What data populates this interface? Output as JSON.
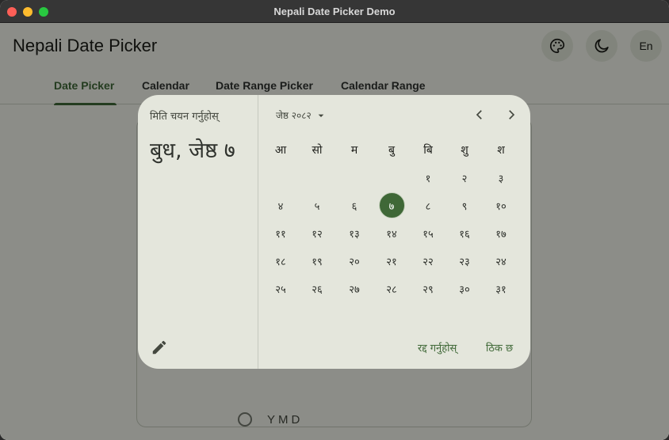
{
  "window": {
    "title": "Nepali Date Picker Demo"
  },
  "app": {
    "title": "Nepali Date Picker",
    "actions": {
      "language_label": "En"
    },
    "tabs": [
      {
        "label": "Date Picker",
        "active": true
      },
      {
        "label": "Calendar",
        "active": false
      },
      {
        "label": "Date Range Picker",
        "active": false
      },
      {
        "label": "Calendar Range",
        "active": false
      }
    ],
    "format_options": [
      {
        "label": "YMD",
        "selected": false
      }
    ]
  },
  "dialog": {
    "help_text": "मिति चयन गर्नुहोस्",
    "headline": "बुध, जेष्ठ ७",
    "month_label": "जेष्ठ २०८२",
    "weekdays": [
      "आ",
      "सो",
      "म",
      "बु",
      "बि",
      "शु",
      "श"
    ],
    "weeks": [
      [
        "",
        "",
        "",
        "",
        "१",
        "२",
        "३"
      ],
      [
        "४",
        "५",
        "६",
        "७",
        "८",
        "९",
        "१०"
      ],
      [
        "११",
        "१२",
        "१३",
        "१४",
        "१५",
        "१६",
        "१७"
      ],
      [
        "१८",
        "१९",
        "२०",
        "२१",
        "२२",
        "२३",
        "२४"
      ],
      [
        "२५",
        "२६",
        "२७",
        "२८",
        "२९",
        "३०",
        "३१"
      ]
    ],
    "selected_day": "७",
    "cancel_label": "रद्द गर्नुहोस्",
    "ok_label": "ठिक छ"
  },
  "colors": {
    "primary": "#3f6837",
    "surface": "#f1f3ea",
    "dialog_surface": "#e4e6dc"
  },
  "icons": [
    "palette-icon",
    "dark-mode-icon",
    "edit-icon",
    "dropdown-arrow-icon",
    "chevron-left-icon",
    "chevron-right-icon"
  ]
}
